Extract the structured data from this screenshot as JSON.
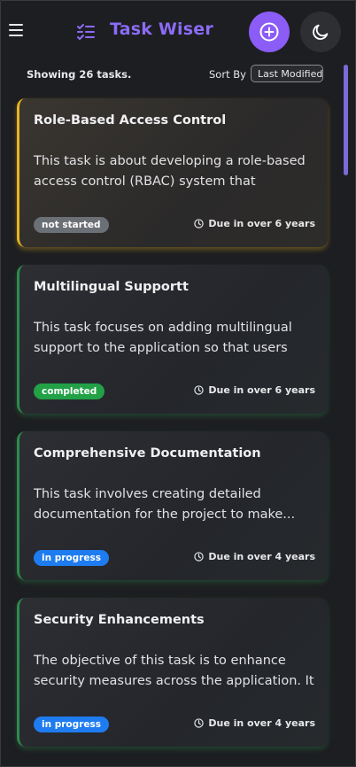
{
  "header": {
    "app_title": "Task Wiser",
    "menu_icon": "hamburger-icon",
    "logo_icon": "checklist-icon",
    "add_icon": "plus-circle-icon",
    "theme_icon": "moon-icon"
  },
  "toolbar": {
    "count_text": "Showing 26 tasks.",
    "sort_label": "Sort By",
    "sort_value": "Last Modified"
  },
  "colors": {
    "accent": "#8b5cf6",
    "not_started": "#6b6f76",
    "completed": "#22a147",
    "in_progress": "#1e7cf0",
    "yellow_border": "#e8b422",
    "green_border": "#2f8a4c"
  },
  "tasks": [
    {
      "title": "Role-Based Access Control",
      "description": "This task is about developing a role-based access control (RBAC) system that ensures...",
      "status": "not started",
      "due": "Due in over 6 years"
    },
    {
      "title": "Multilingual Supportt",
      "description": "This task focuses on adding multilingual support to the application so that users acros...",
      "status": "completed",
      "due": "Due in over 6 years"
    },
    {
      "title": "Comprehensive Documentation",
      "description": "This task involves creating detailed documentation for the project to make...",
      "status": "in progress",
      "due": "Due in over 4 years"
    },
    {
      "title": "Security Enhancements",
      "description": "The objective of this task is to enhance security measures across the application. It involves...",
      "status": "in progress",
      "due": "Due in over 4 years"
    }
  ]
}
